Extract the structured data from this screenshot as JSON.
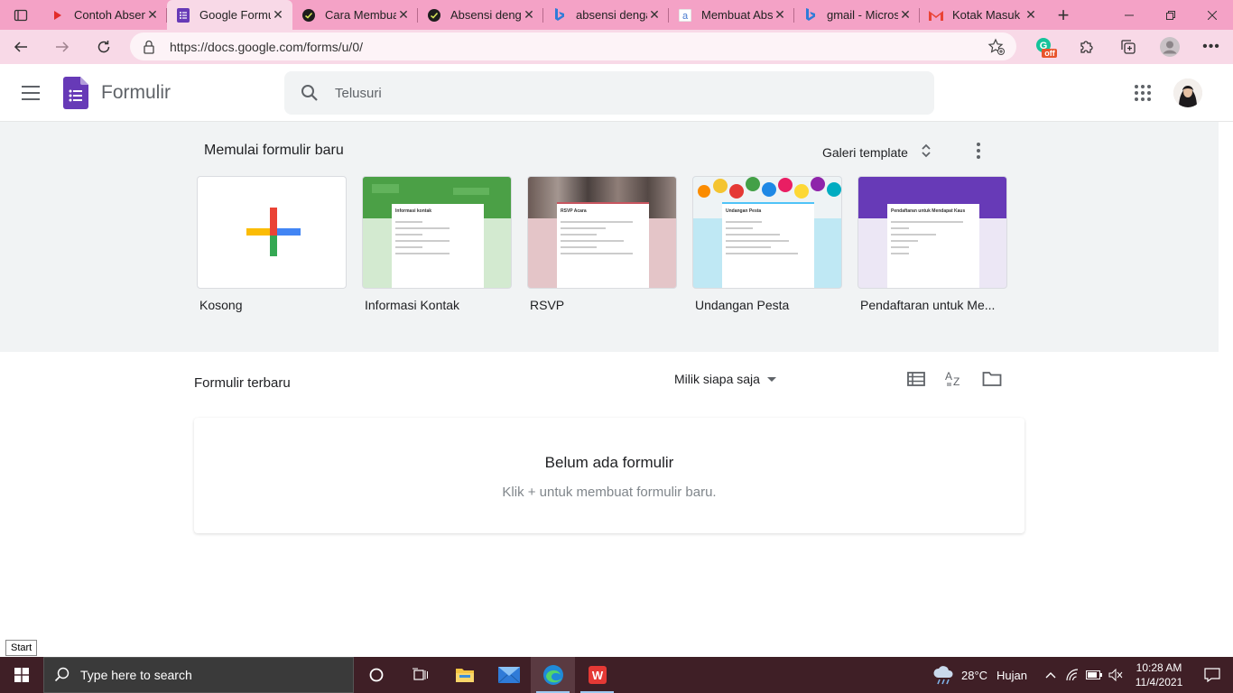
{
  "browser": {
    "tabs": [
      {
        "label": "Contoh Absen",
        "favicon": "youtube-icon"
      },
      {
        "label": "Google Formulir",
        "favicon": "google-forms-icon",
        "active": true
      },
      {
        "label": "Cara Membuat",
        "favicon": "site-icon"
      },
      {
        "label": "Absensi dengan",
        "favicon": "site-icon"
      },
      {
        "label": "absensi dengan",
        "favicon": "bing-icon"
      },
      {
        "label": "Membuat Absen",
        "favicon": "a-icon"
      },
      {
        "label": "gmail - Microsoft",
        "favicon": "bing-icon"
      },
      {
        "label": "Kotak Masuk",
        "favicon": "gmail-icon"
      }
    ],
    "url": "https://docs.google.com/forms/u/0/",
    "extension_badge": "off"
  },
  "app": {
    "title": "Formulir",
    "search_placeholder": "Telusuri"
  },
  "templates": {
    "heading": "Memulai formulir baru",
    "gallery_label": "Galeri template",
    "items": [
      {
        "name": "Kosong"
      },
      {
        "name": "Informasi Kontak",
        "doc_title": "Informasi kontak"
      },
      {
        "name": "RSVP",
        "doc_title": "RSVP Acara"
      },
      {
        "name": "Undangan Pesta",
        "doc_title": "Undangan Pesta"
      },
      {
        "name": "Pendaftaran untuk Me...",
        "doc_title": "Pendaftaran untuk Mendapat Kaus"
      }
    ]
  },
  "recent": {
    "heading": "Formulir terbaru",
    "owner_filter": "Milik siapa saja",
    "empty_title": "Belum ada formulir",
    "empty_subtitle": "Klik + untuk membuat formulir baru."
  },
  "tooltip": "Start",
  "taskbar": {
    "search_placeholder": "Type here to search",
    "temperature": "28°C",
    "weather": "Hujan",
    "time": "10:28 AM",
    "date": "11/4/2021"
  },
  "colors": {
    "tab_strip": "#f4a2c6",
    "toolbar": "#f8d9e7",
    "forms_purple": "#673ab7",
    "taskbar": "#3f1f26"
  }
}
